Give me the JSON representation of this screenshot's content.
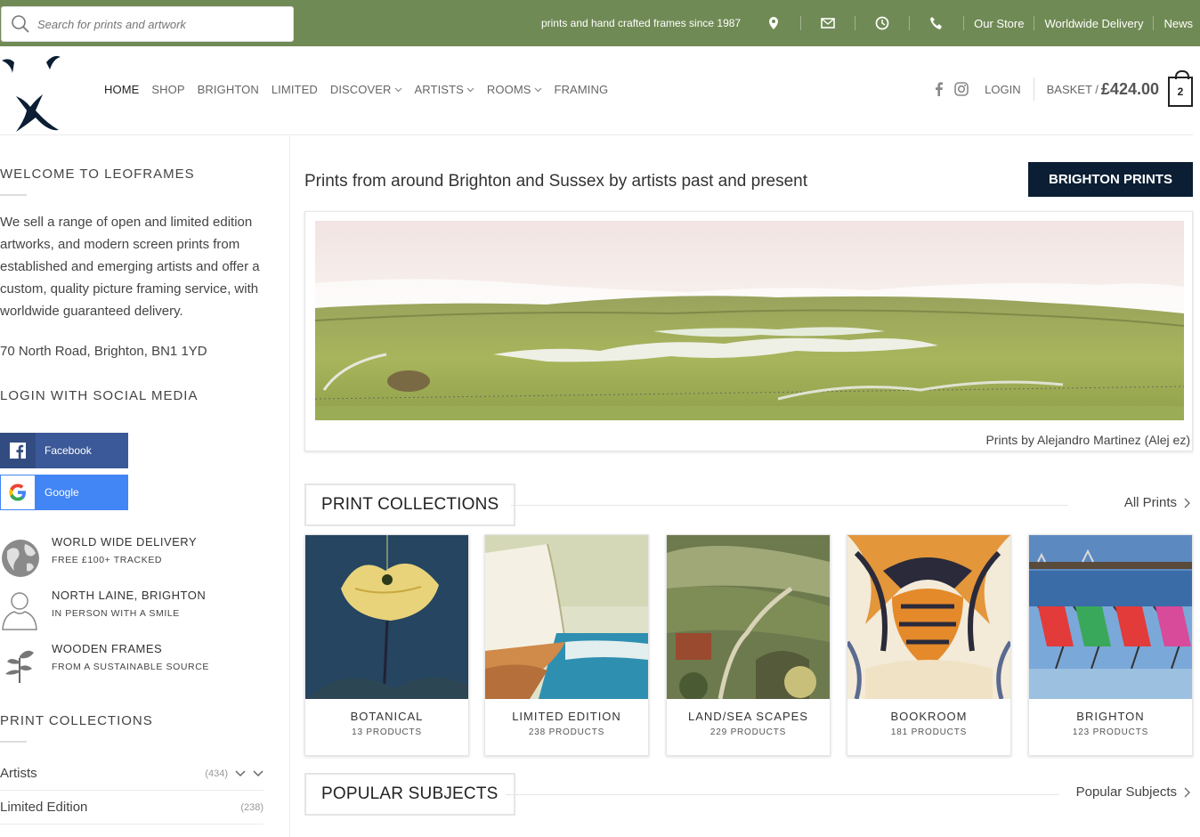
{
  "search": {
    "placeholder": "Search for prints and artwork"
  },
  "topbar": {
    "tagline": "prints and hand crafted frames since 1987",
    "links": [
      "Our Store",
      "Worldwide Delivery",
      "News"
    ]
  },
  "nav": {
    "items": [
      "HOME",
      "SHOP",
      "BRIGHTON",
      "LIMITED",
      "DISCOVER",
      "ARTISTS",
      "ROOMS",
      "FRAMING"
    ]
  },
  "header": {
    "login": "LOGIN",
    "basket_label": "BASKET /",
    "basket_amount": "£424.00",
    "cart_count": "2"
  },
  "sidebar": {
    "welcome_title": "WELCOME TO LEOFRAMES",
    "welcome_text": "We sell a range of open and limited edition artworks, and modern screen prints from established and emerging artists and offer a custom, quality picture framing service, with worldwide guaranteed delivery.",
    "address": "70 North Road, Brighton, BN1 1YD",
    "social_title": "LOGIN WITH SOCIAL MEDIA",
    "facebook": "Facebook",
    "google": "Google",
    "features": [
      {
        "title": "WORLD WIDE DELIVERY",
        "sub": "FREE £100+ TRACKED",
        "icon": "globe-icon"
      },
      {
        "title": "NORTH LAINE, BRIGHTON",
        "sub": "IN PERSON WITH A SMILE",
        "icon": "person-icon"
      },
      {
        "title": "WOODEN FRAMES",
        "sub": "FROM A SUSTAINABLE SOURCE",
        "icon": "tree-icon"
      }
    ],
    "collections_title": "PRINT COLLECTIONS",
    "categories": [
      {
        "label": "Artists",
        "count": "(434)"
      },
      {
        "label": "Limited Edition",
        "count": "(238)"
      }
    ]
  },
  "main": {
    "title": "Prints from around Brighton and Sussex by artists past and present",
    "cta": "BRIGHTON PRINTS",
    "banner_caption": "Prints by Alejandro Martinez (Alej ez)",
    "collections_heading": "PRINT COLLECTIONS",
    "collections_link": "All Prints",
    "collections": [
      {
        "title": "BOTANICAL",
        "count": "13 PRODUCTS"
      },
      {
        "title": "LIMITED EDITION",
        "count": "238 PRODUCTS"
      },
      {
        "title": "LAND/SEA SCAPES",
        "count": "229 PRODUCTS"
      },
      {
        "title": "BOOKROOM",
        "count": "181 PRODUCTS"
      },
      {
        "title": "BRIGHTON",
        "count": "123 PRODUCTS"
      }
    ],
    "popular_heading": "POPULAR SUBJECTS",
    "popular_link": "Popular Subjects"
  },
  "colors": {
    "topbar": "#708a55",
    "cta": "#0b1e33",
    "facebook": "#3b5998",
    "google": "#4285f4"
  }
}
